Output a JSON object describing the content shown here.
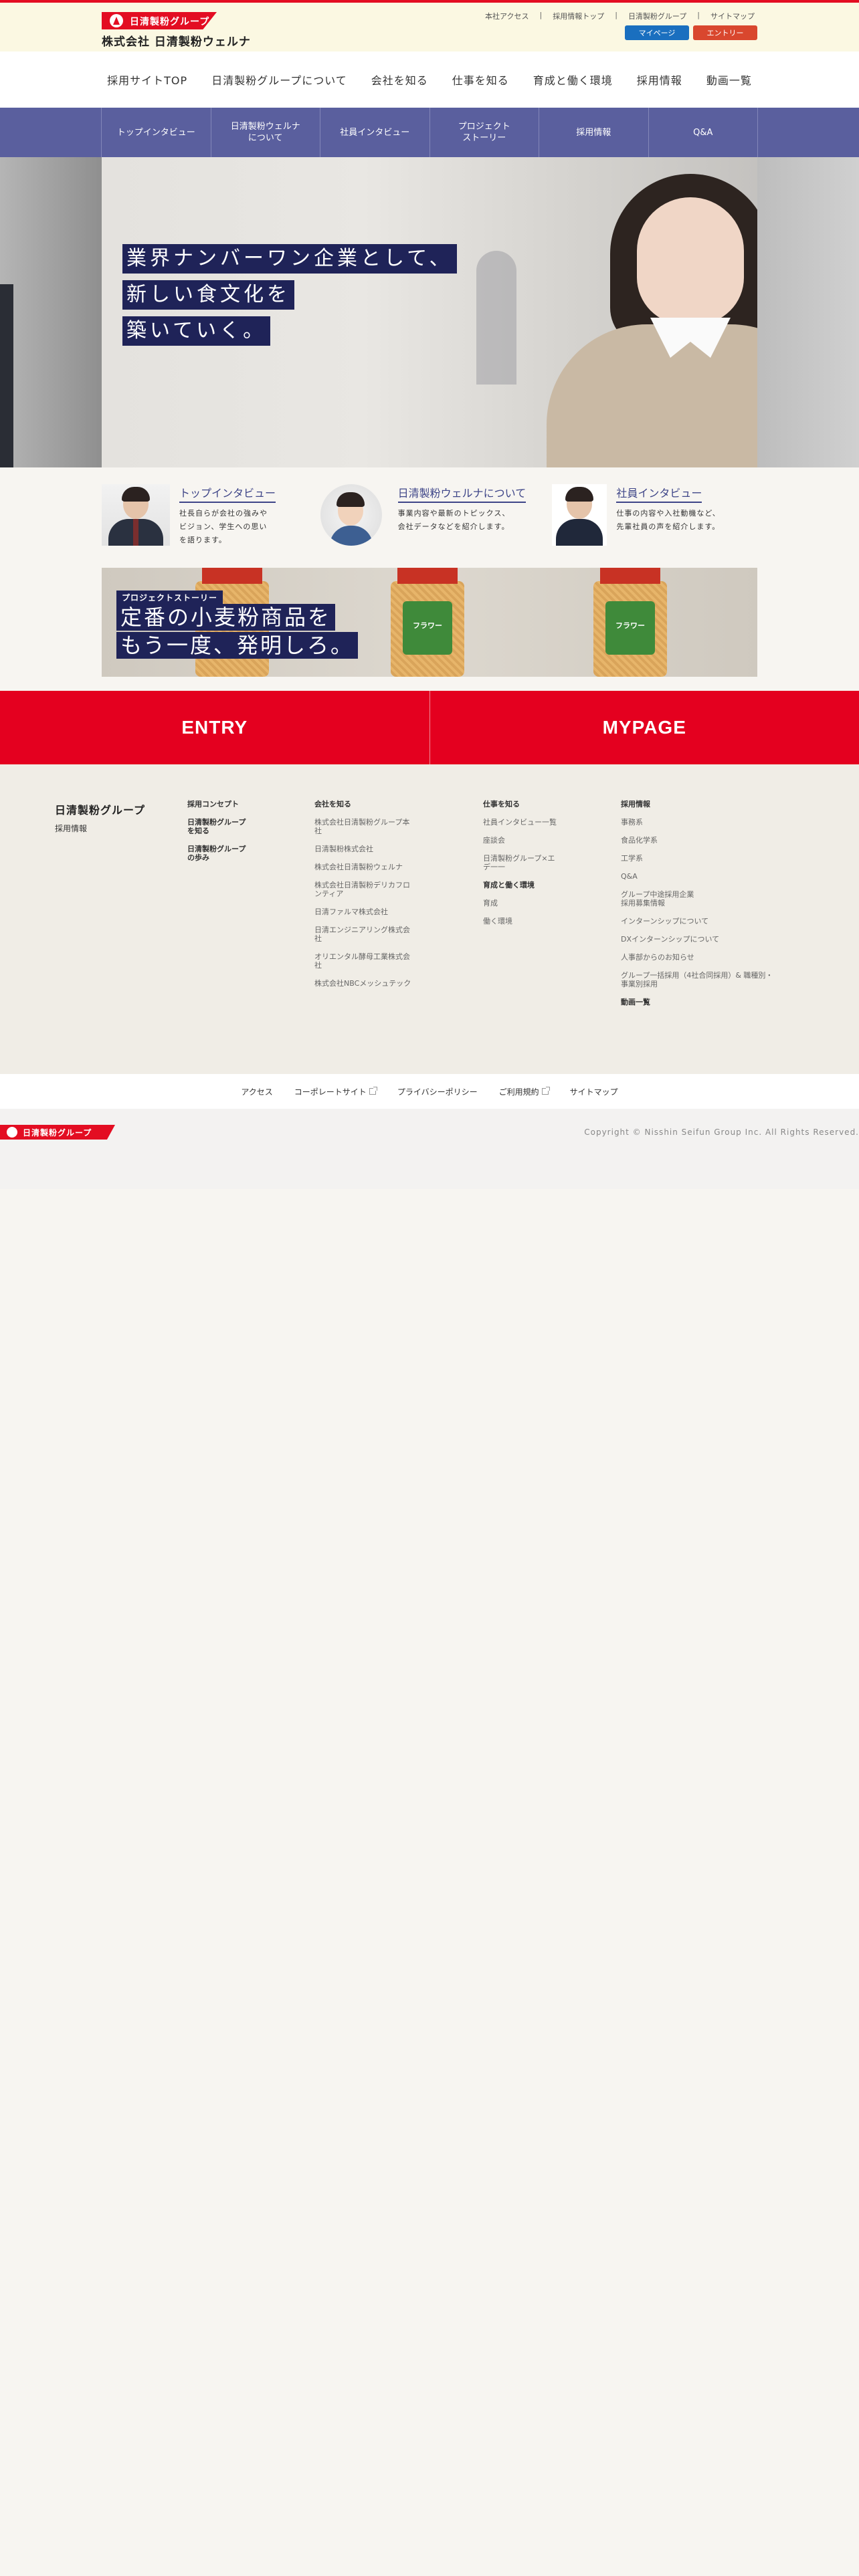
{
  "header": {
    "logo_group": "日清製粉グループ",
    "logo_company": "株式会社 日清製粉ウェルナ",
    "util_links": [
      "本社アクセス",
      "採用情報トップ",
      "日清製粉グループ",
      "サイトマップ"
    ],
    "mypage_label": "マイページ",
    "entry_label": "エントリー"
  },
  "main_nav": [
    "採用サイトTOP",
    "日清製粉グループについて",
    "会社を知る",
    "仕事を知る",
    "育成と働く環境",
    "採用情報",
    "動画一覧"
  ],
  "sub_nav": [
    "トップインタビュー",
    "日清製粉ウェルナ\nについて",
    "社員インタビュー",
    "プロジェクト\nストーリー",
    "採用情報",
    "Q&A"
  ],
  "hero": {
    "lines": [
      "業界ナンバーワン企業として、",
      "新しい食文化を",
      "築いていく。"
    ]
  },
  "features": [
    {
      "title": "トップインタビュー",
      "desc": "社長自らが会社の強みや\nビジョン、学生への思い\nを語ります。"
    },
    {
      "title": "日清製粉ウェルナについて",
      "desc": "事業内容や最新のトピックス、\n会社データなどを紹介します。"
    },
    {
      "title": "社員インタビュー",
      "desc": "仕事の内容や入社動機など、\n先輩社員の声を紹介します。"
    }
  ],
  "project": {
    "tag": "プロジェクトストーリー",
    "line1": "定番の小麦粉商品を",
    "line2": "もう一度、発明しろ。",
    "jar_label": "フラワー"
  },
  "cta": {
    "entry": "ENTRY",
    "mypage": "MYPAGE"
  },
  "footer": {
    "brand_logo": "日清製粉グループ",
    "brand_sub": "採用情報",
    "col1": {
      "links": [
        "採用コンセプト",
        "日清製粉グループ\nを知る",
        "日清製粉グループ\nの歩み"
      ]
    },
    "col2": {
      "head": "会社を知る",
      "links": [
        "株式会社日清製粉グループ本\n社",
        "日清製粉株式会社",
        "株式会社日清製粉ウェルナ",
        "株式会社日清製粉デリカフロ\nンティア",
        "日清ファルマ株式会社",
        "日清エンジニアリング株式会\n社",
        "オリエンタル酵母工業株式会\n社",
        "株式会社NBCメッシュテック"
      ]
    },
    "col3": {
      "head": "仕事を知る",
      "links": [
        "社員インタビュー一覧",
        "座談会",
        "日清製粉グループ×エ\nデ一一"
      ],
      "head2": "育成と働く環境",
      "links2": [
        "育成",
        "働く環境"
      ]
    },
    "col4": {
      "head": "採用情報",
      "links": [
        "事務系",
        "食品化学系",
        "工学系",
        "Q&A",
        "グループ中途採用企業\n採用募集情報",
        "インターンシップについて",
        "DXインターンシップについて",
        "人事部からのお知らせ",
        "グループ一括採用（4社合同採用）& 職種別・\n事業別採用"
      ],
      "tail": "動画一覧"
    }
  },
  "bottom_links": [
    "アクセス",
    "コーポレートサイト",
    "プライバシーポリシー",
    "ご利用規約",
    "サイトマップ"
  ],
  "copy": {
    "logo": "日清製粉グループ",
    "copyright": "Copyright © Nisshin Seifun Group Inc. All Rights Reserved."
  }
}
